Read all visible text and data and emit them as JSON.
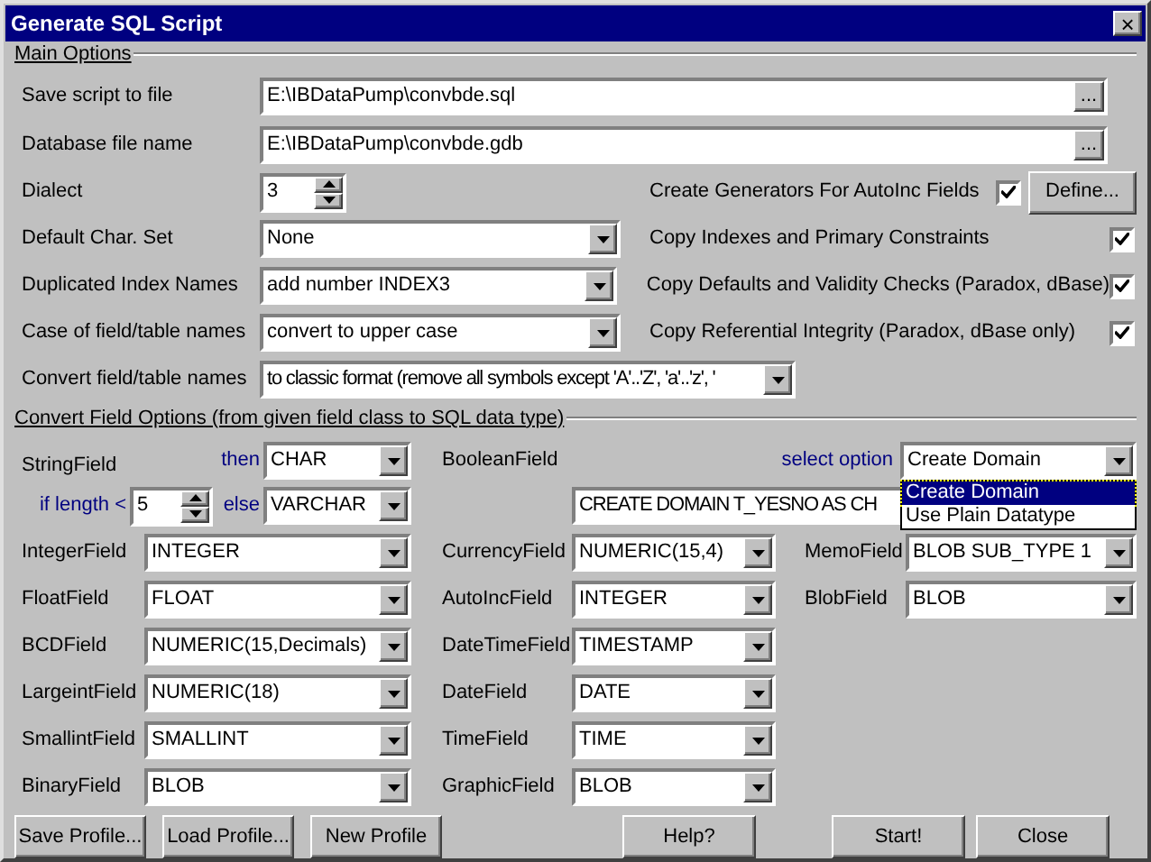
{
  "window": {
    "title": "Generate SQL Script",
    "close": "×"
  },
  "main_options": {
    "title": "Main Options",
    "file_rows": [
      {
        "label": "Save script to file",
        "value": "E:\\IBDataPump\\convbde.sql",
        "button": "..."
      },
      {
        "label": "Database file name",
        "value": "E:\\IBDataPump\\convbde.gdb",
        "button": "..."
      }
    ],
    "dialect": {
      "label": "Dialect",
      "value": "3"
    },
    "selects": [
      {
        "label": "Default Char. Set",
        "value": "None"
      },
      {
        "label": "Duplicated Index Names",
        "value": "add number INDEX3"
      },
      {
        "label": "Case of field/table names",
        "value": "convert to upper case"
      },
      {
        "label": "Convert field/table names",
        "value": "to classic format (remove all symbols except 'A'..'Z', 'a'..'z', '"
      }
    ],
    "checks": [
      {
        "label": "Create Generators For AutoInc Fields",
        "checked": true
      },
      {
        "label": "Copy Indexes and Primary Constraints",
        "checked": true
      },
      {
        "label": "Copy Defaults and Validity Checks (Paradox, dBase)",
        "checked": true
      },
      {
        "label": "Copy Referential Integrity (Paradox, dBase only)",
        "checked": true
      }
    ],
    "define_button": "Define..."
  },
  "field_options": {
    "title": "Convert Field Options (from given field class to SQL data type)",
    "string_field": {
      "label": "StringField",
      "length_label": "if length <",
      "length": "5",
      "then_label": "then",
      "then_value": "CHAR",
      "else_label": "else",
      "else_value": "VARCHAR"
    },
    "boolean_field": {
      "label": "BooleanField",
      "option_label": "select option",
      "option": "Create Domain",
      "domain_sql": "CREATE DOMAIN T_YESNO AS CH",
      "dropdown": [
        {
          "label": "Create Domain",
          "selected": true
        },
        {
          "label": "Use Plain Datatype",
          "selected": false
        }
      ]
    },
    "rows": [
      [
        {
          "label": "IntegerField",
          "value": "INTEGER"
        },
        {
          "label": "CurrencyField",
          "value": "NUMERIC(15,4)"
        },
        {
          "label": "MemoField",
          "value": "BLOB SUB_TYPE 1"
        }
      ],
      [
        {
          "label": "FloatField",
          "value": "FLOAT"
        },
        {
          "label": "AutoIncField",
          "value": "INTEGER"
        },
        {
          "label": "BlobField",
          "value": "BLOB"
        }
      ],
      [
        {
          "label": "BCDField",
          "value": "NUMERIC(15,Decimals)"
        },
        {
          "label": "DateTimeField",
          "value": "TIMESTAMP"
        }
      ],
      [
        {
          "label": "LargeintField",
          "value": "NUMERIC(18)"
        },
        {
          "label": "DateField",
          "value": "DATE"
        }
      ],
      [
        {
          "label": "SmallintField",
          "value": "SMALLINT"
        },
        {
          "label": "TimeField",
          "value": "TIME"
        }
      ],
      [
        {
          "label": "BinaryField",
          "value": "BLOB"
        },
        {
          "label": "GraphicField",
          "value": "BLOB"
        }
      ]
    ]
  },
  "profile_buttons": [
    "Save Profile...",
    "Load Profile...",
    "New Profile"
  ],
  "help_button": "Help?",
  "action_buttons": [
    "Start!",
    "Close"
  ]
}
